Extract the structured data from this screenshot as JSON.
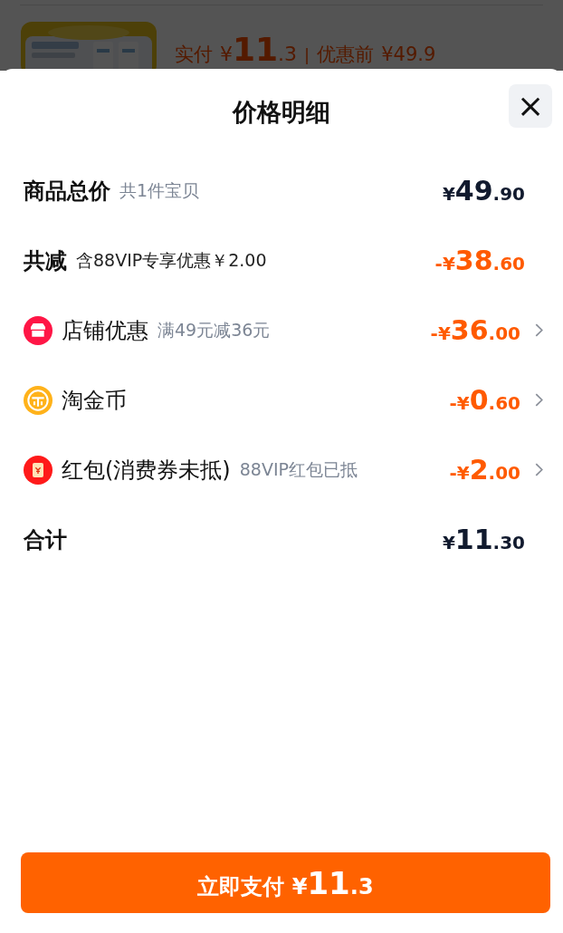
{
  "background": {
    "paid_label": "实付",
    "paid_currency": "¥",
    "paid_whole": "11",
    "paid_fraction": ".3",
    "separator": "|",
    "original_label": "优惠前",
    "original_price": "¥49.9"
  },
  "sheet": {
    "title": "价格明细",
    "close": "×",
    "rows": [
      {
        "kind": "plain",
        "label": "商品总价",
        "note": "共1件宝贝",
        "sign": "",
        "currency": "¥",
        "whole": "49",
        "fraction": ".90",
        "bold": true,
        "discount": false,
        "chevron": false
      },
      {
        "kind": "plain",
        "label": "共减",
        "note": "含88VIP专享优惠￥2.00",
        "sign": "-",
        "currency": "¥",
        "whole": "38",
        "fraction": ".60",
        "bold": true,
        "discount": true,
        "chevron": false
      },
      {
        "kind": "store",
        "label": "店铺优惠",
        "note": "满49元减36元",
        "sign": "-",
        "currency": "¥",
        "whole": "36",
        "fraction": ".00",
        "bold": false,
        "discount": true,
        "chevron": true
      },
      {
        "kind": "coin",
        "label": "淘金币",
        "sign": "-",
        "currency": "¥",
        "whole": "0",
        "fraction": ".60",
        "bold": false,
        "discount": true,
        "chevron": true
      },
      {
        "kind": "redpacket",
        "label": "红包(消费券未抵)",
        "note": "88VIP红包已抵",
        "sign": "-",
        "currency": "¥",
        "whole": "2",
        "fraction": ".00",
        "bold": false,
        "discount": true,
        "chevron": true
      },
      {
        "kind": "plain",
        "label": "合计",
        "sign": "",
        "currency": "¥",
        "whole": "11",
        "fraction": ".30",
        "bold": true,
        "discount": false,
        "chevron": false
      }
    ],
    "pay_button": {
      "label": "立即支付",
      "currency": "¥",
      "whole": "11",
      "fraction": ".3"
    }
  }
}
